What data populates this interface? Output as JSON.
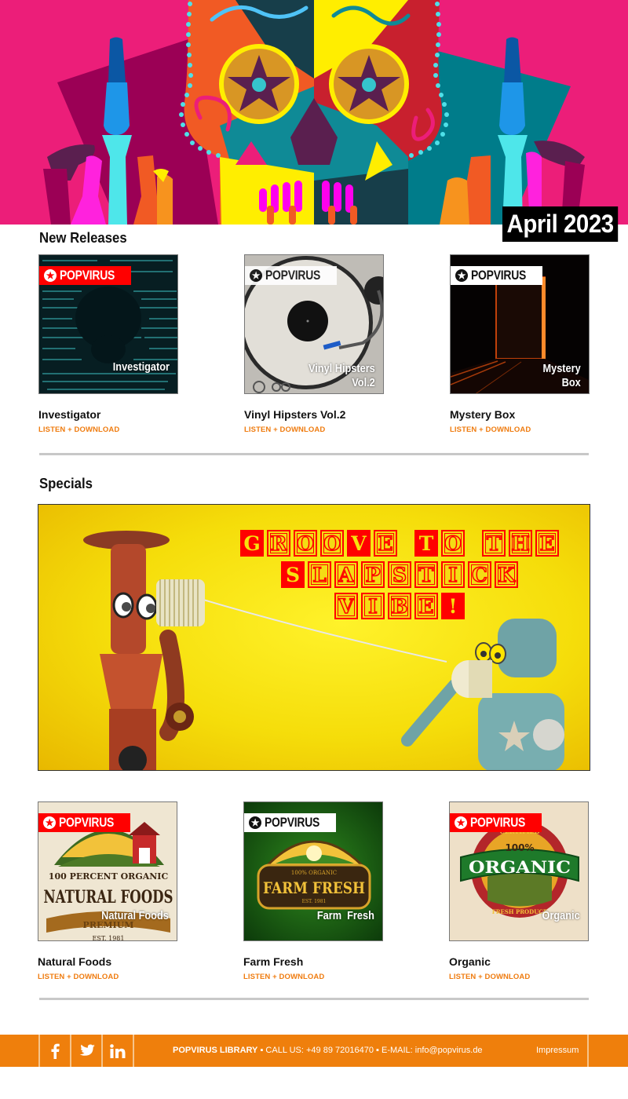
{
  "header": {
    "hero_alt": "Day of the dead sugar skull illustration",
    "date_badge": "April 2023",
    "colors": {
      "pink": "#ec1e79",
      "teal": "#007c8a",
      "yellow": "#ffee00",
      "orange": "#f15a24"
    }
  },
  "new_releases": {
    "title": "New Releases",
    "items": [
      {
        "name": "Investigator",
        "cover_brand": "POPVIRUS",
        "cover_title": "Investigator",
        "link": "LISTEN + DOWNLOAD"
      },
      {
        "name": "Vinyl Hipsters Vol.2",
        "cover_brand": "POPVIRUS",
        "cover_title_line1": "Vinyl Hipsters",
        "cover_title_line2": "Vol.2",
        "link": "LISTEN + DOWNLOAD"
      },
      {
        "name": "Mystery Box",
        "cover_brand": "POPVIRUS",
        "cover_title_line1": "Mystery",
        "cover_title_line2": "Box",
        "link": "LISTEN + DOWNLOAD"
      }
    ]
  },
  "specials": {
    "title": "Specials",
    "banner": {
      "headline_line1": "GROOVE TO THE",
      "headline_line2": "SLAPSTICK",
      "headline_line3": "VIBE!"
    },
    "items": [
      {
        "name": "Natural Foods",
        "cover_brand": "POPVIRUS",
        "cover_title": "Natural Foods",
        "cover_art_line1": "100 PERCENT ORGANIC",
        "cover_art_line2": "NATURAL FOODS",
        "cover_art_line3": "PREMIUM",
        "cover_art_line4": "EST. 1981",
        "link": "LISTEN + DOWNLOAD"
      },
      {
        "name": "Farm Fresh",
        "cover_brand": "POPVIRUS",
        "cover_title": "Farm  Fresh",
        "cover_art_line1": "100% ORGANIC",
        "cover_art_line2": "FARM FRESH",
        "cover_art_line3": "EST. 1981",
        "link": "LISTEN + DOWNLOAD"
      },
      {
        "name": "Organic",
        "cover_brand": "POPVIRUS",
        "cover_title": "Organic",
        "cover_art_line1": "CERTIFIED",
        "cover_art_line2": "100%",
        "cover_art_line3": "ORGANIC",
        "cover_art_line4": "FRESH PRODUCE",
        "link": "LISTEN + DOWNLOAD"
      }
    ]
  },
  "footer": {
    "social": [
      {
        "name": "facebook",
        "glyph": "f"
      },
      {
        "name": "twitter",
        "glyph": "t"
      },
      {
        "name": "linkedin",
        "glyph": "in"
      }
    ],
    "company": "POPVIRUS LIBRARY",
    "bullet": "▪",
    "call_label": "CALL US:",
    "phone": "+49 89 72016470",
    "email_label": "E-MAIL:",
    "email": "info@popvirus.de",
    "impressum": "Impressum",
    "accent_color": "#ef7f0c"
  }
}
